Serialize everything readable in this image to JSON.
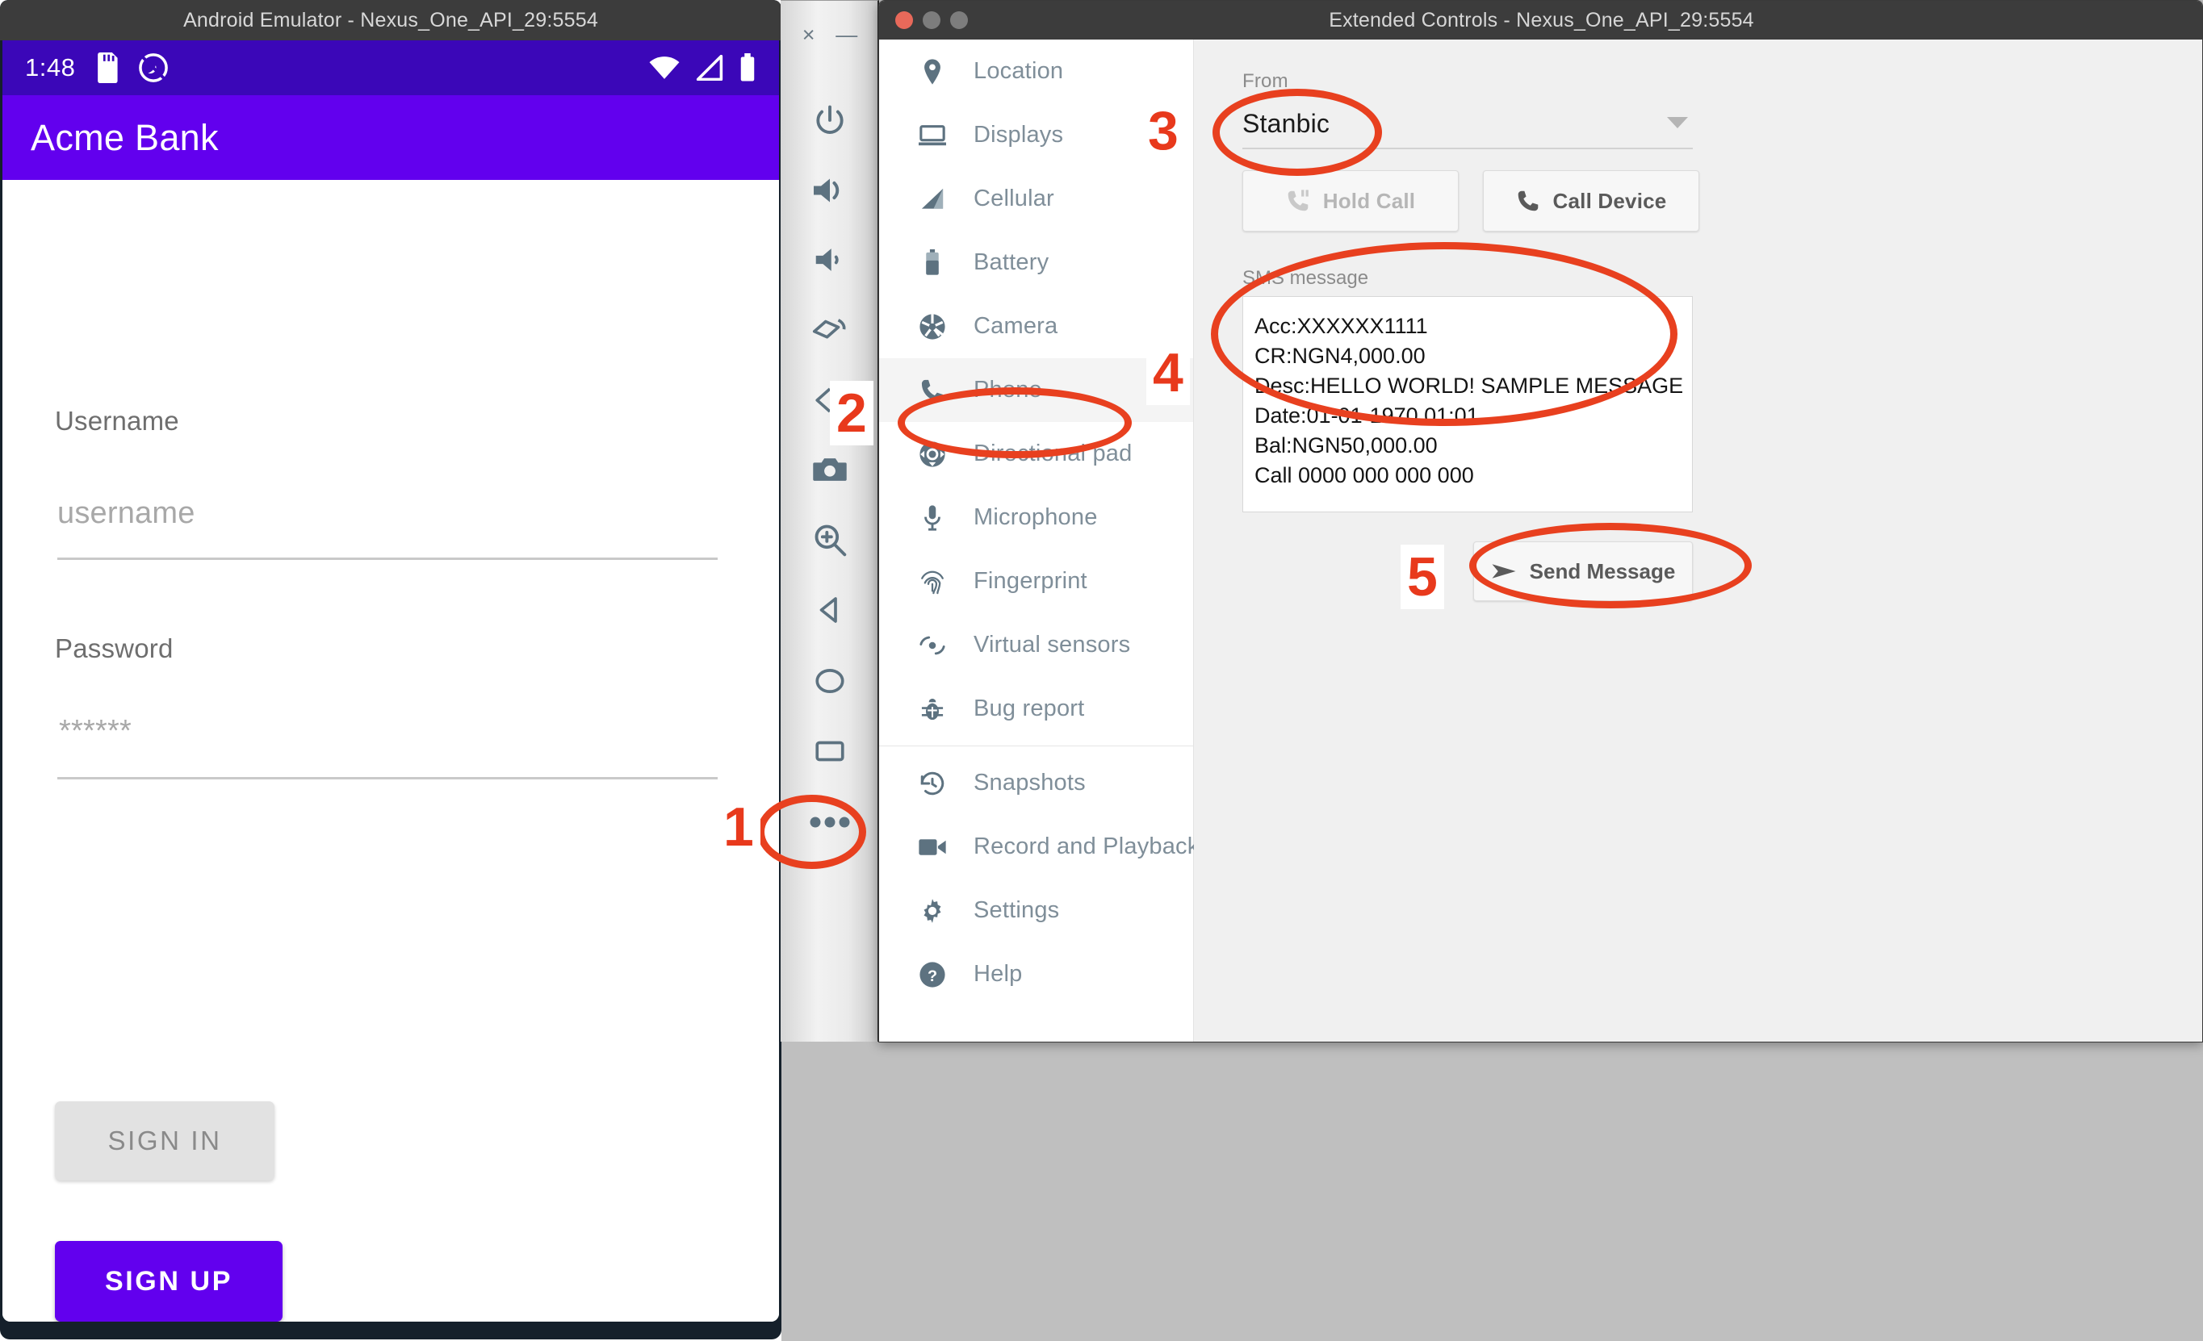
{
  "emulator_window": {
    "title": "Android Emulator - Nexus_One_API_29:5554",
    "status_bar": {
      "time": "1:48",
      "icons_left": [
        "sd-card-icon",
        "dnd-icon"
      ],
      "icons_right": [
        "wifi-icon",
        "cellular-signal-icon",
        "battery-icon"
      ]
    },
    "app_bar": {
      "title": "Acme Bank"
    },
    "login_form": {
      "username_label": "Username",
      "username_placeholder": "username",
      "password_label": "Password",
      "password_value": "******",
      "sign_in_label": "SIGN IN",
      "sign_up_label": "SIGN UP"
    }
  },
  "emulator_toolbar": {
    "close_label": "×",
    "minimize_label": "—",
    "buttons": [
      {
        "name": "power-icon"
      },
      {
        "name": "volume-up-icon"
      },
      {
        "name": "volume-down-icon"
      },
      {
        "name": "rotate-left-icon"
      },
      {
        "name": "rotate-right-icon"
      },
      {
        "name": "screenshot-icon"
      },
      {
        "name": "zoom-icon"
      },
      {
        "name": "back-icon"
      },
      {
        "name": "home-icon"
      },
      {
        "name": "overview-icon"
      },
      {
        "name": "more-icon"
      }
    ]
  },
  "extended_controls": {
    "title": "Extended Controls - Nexus_One_API_29:5554",
    "traffic_lights": [
      "close",
      "minimize",
      "zoom"
    ],
    "menu": [
      {
        "label": "Location",
        "icon": "location-pin-icon",
        "active": false
      },
      {
        "label": "Displays",
        "icon": "display-icon",
        "active": false
      },
      {
        "label": "Cellular",
        "icon": "cellular-icon",
        "active": false
      },
      {
        "label": "Battery",
        "icon": "battery-icon",
        "active": false
      },
      {
        "label": "Camera",
        "icon": "camera-aperture-icon",
        "active": false
      },
      {
        "label": "Phone",
        "icon": "phone-icon",
        "active": true
      },
      {
        "label": "Directional pad",
        "icon": "dpad-icon",
        "active": false
      },
      {
        "label": "Microphone",
        "icon": "microphone-icon",
        "active": false
      },
      {
        "label": "Fingerprint",
        "icon": "fingerprint-icon",
        "active": false
      },
      {
        "label": "Virtual sensors",
        "icon": "virtual-sensors-icon",
        "active": false
      },
      {
        "label": "Bug report",
        "icon": "bug-icon",
        "active": false
      },
      {
        "label": "Snapshots",
        "icon": "snapshot-history-icon",
        "active": false
      },
      {
        "label": "Record and Playback",
        "icon": "video-camera-icon",
        "active": false
      },
      {
        "label": "Settings",
        "icon": "gear-icon",
        "active": false
      },
      {
        "label": "Help",
        "icon": "help-circle-icon",
        "active": false
      }
    ],
    "phone_panel": {
      "from_label": "From",
      "from_value": "Stanbic",
      "hold_call_label": "Hold Call",
      "call_device_label": "Call Device",
      "sms_label": "SMS message",
      "sms_lines": [
        "Acc:XXXXXX1111",
        "CR:NGN4,000.00",
        "Desc:HELLO WORLD! SAMPLE MESSAGE",
        "Date:01-01-1970 01:01",
        "Bal:NGN50,000.00",
        "Call 0000 000 000 000"
      ],
      "send_message_label": "Send Message"
    }
  },
  "annotations": {
    "color": "#e8401f",
    "steps": [
      {
        "number": "1",
        "target": "more-icon"
      },
      {
        "number": "2",
        "target": "menu-item-phone"
      },
      {
        "number": "3",
        "target": "from-field"
      },
      {
        "number": "4",
        "target": "sms-message-box"
      },
      {
        "number": "5",
        "target": "send-message-button"
      }
    ]
  }
}
